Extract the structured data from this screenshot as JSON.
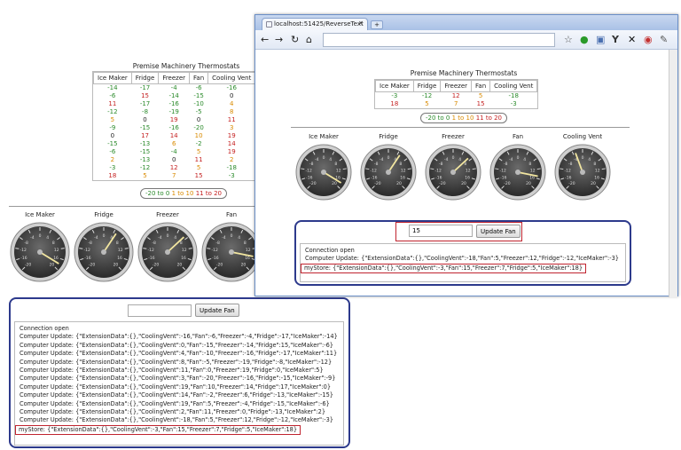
{
  "back": {
    "title": "Premise Machinery Thermostats",
    "columns": [
      "Ice Maker",
      "Fridge",
      "Freezer",
      "Fan",
      "Cooling Vent"
    ],
    "rows": [
      [
        {
          "v": "-14",
          "c": "green"
        },
        {
          "v": "-17",
          "c": "green"
        },
        {
          "v": "-4",
          "c": "green"
        },
        {
          "v": "-6",
          "c": "green"
        },
        {
          "v": "-16",
          "c": "green"
        }
      ],
      [
        {
          "v": "-6",
          "c": "green"
        },
        {
          "v": "15",
          "c": "red"
        },
        {
          "v": "-14",
          "c": "green"
        },
        {
          "v": "-15",
          "c": "green"
        },
        {
          "v": "0",
          "c": "dark"
        }
      ],
      [
        {
          "v": "11",
          "c": "red"
        },
        {
          "v": "-17",
          "c": "green"
        },
        {
          "v": "-16",
          "c": "green"
        },
        {
          "v": "-10",
          "c": "green"
        },
        {
          "v": "4",
          "c": "orange"
        }
      ],
      [
        {
          "v": "-12",
          "c": "green"
        },
        {
          "v": "-8",
          "c": "green"
        },
        {
          "v": "-19",
          "c": "green"
        },
        {
          "v": "-5",
          "c": "green"
        },
        {
          "v": "8",
          "c": "orange"
        }
      ],
      [
        {
          "v": "5",
          "c": "orange"
        },
        {
          "v": "0",
          "c": "dark"
        },
        {
          "v": "19",
          "c": "red"
        },
        {
          "v": "0",
          "c": "dark"
        },
        {
          "v": "11",
          "c": "red"
        }
      ],
      [
        {
          "v": "-9",
          "c": "green"
        },
        {
          "v": "-15",
          "c": "green"
        },
        {
          "v": "-16",
          "c": "green"
        },
        {
          "v": "-20",
          "c": "green"
        },
        {
          "v": "3",
          "c": "orange"
        }
      ],
      [
        {
          "v": "0",
          "c": "dark"
        },
        {
          "v": "17",
          "c": "red"
        },
        {
          "v": "14",
          "c": "red"
        },
        {
          "v": "10",
          "c": "orange"
        },
        {
          "v": "19",
          "c": "red"
        }
      ],
      [
        {
          "v": "-15",
          "c": "green"
        },
        {
          "v": "-13",
          "c": "green"
        },
        {
          "v": "6",
          "c": "orange"
        },
        {
          "v": "-2",
          "c": "green"
        },
        {
          "v": "14",
          "c": "red"
        }
      ],
      [
        {
          "v": "-6",
          "c": "green"
        },
        {
          "v": "-15",
          "c": "green"
        },
        {
          "v": "-4",
          "c": "green"
        },
        {
          "v": "5",
          "c": "orange"
        },
        {
          "v": "19",
          "c": "red"
        }
      ],
      [
        {
          "v": "2",
          "c": "orange"
        },
        {
          "v": "-13",
          "c": "green"
        },
        {
          "v": "0",
          "c": "dark"
        },
        {
          "v": "11",
          "c": "red"
        },
        {
          "v": "2",
          "c": "orange"
        }
      ],
      [
        {
          "v": "-3",
          "c": "green"
        },
        {
          "v": "-12",
          "c": "green"
        },
        {
          "v": "12",
          "c": "red"
        },
        {
          "v": "5",
          "c": "orange"
        },
        {
          "v": "-18",
          "c": "green"
        }
      ],
      [
        {
          "v": "18",
          "c": "red"
        },
        {
          "v": "5",
          "c": "orange"
        },
        {
          "v": "7",
          "c": "orange"
        },
        {
          "v": "15",
          "c": "red"
        },
        {
          "v": "-3",
          "c": "green"
        }
      ]
    ],
    "legend": {
      "green": "-20 to 0",
      "orange": "1 to 10",
      "red": "11 to 20"
    },
    "gauges": [
      {
        "label": "Ice Maker",
        "value": 18
      },
      {
        "label": "Fridge",
        "value": 5
      },
      {
        "label": "Freezer",
        "value": 7
      },
      {
        "label": "Fan",
        "value": 15
      }
    ],
    "input_value": "",
    "button_label": "Update Fan",
    "log": [
      "Connection open",
      "Computer Update: {\"ExtensionData\":{},\"CoolingVent\":-16,\"Fan\":-6,\"Freezer\":-4,\"Fridge\":-17,\"IceMaker\":-14}",
      "Computer Update: {\"ExtensionData\":{},\"CoolingVent\":0,\"Fan\":-15,\"Freezer\":-14,\"Fridge\":15,\"IceMaker\":-6}",
      "Computer Update: {\"ExtensionData\":{},\"CoolingVent\":4,\"Fan\":-10,\"Freezer\":-16,\"Fridge\":-17,\"IceMaker\":11}",
      "Computer Update: {\"ExtensionData\":{},\"CoolingVent\":8,\"Fan\":-5,\"Freezer\":-19,\"Fridge\":-8,\"IceMaker\":-12}",
      "Computer Update: {\"ExtensionData\":{},\"CoolingVent\":11,\"Fan\":0,\"Freezer\":19,\"Fridge\":0,\"IceMaker\":5}",
      "Computer Update: {\"ExtensionData\":{},\"CoolingVent\":3,\"Fan\":-20,\"Freezer\":-16,\"Fridge\":-15,\"IceMaker\":-9}",
      "Computer Update: {\"ExtensionData\":{},\"CoolingVent\":19,\"Fan\":10,\"Freezer\":14,\"Fridge\":17,\"IceMaker\":0}",
      "Computer Update: {\"ExtensionData\":{},\"CoolingVent\":14,\"Fan\":-2,\"Freezer\":6,\"Fridge\":-13,\"IceMaker\":-15}",
      "Computer Update: {\"ExtensionData\":{},\"CoolingVent\":19,\"Fan\":5,\"Freezer\":-4,\"Fridge\":-15,\"IceMaker\":-6}",
      "Computer Update: {\"ExtensionData\":{},\"CoolingVent\":2,\"Fan\":11,\"Freezer\":0,\"Fridge\":-13,\"IceMaker\":2}",
      "Computer Update: {\"ExtensionData\":{},\"CoolingVent\":-18,\"Fan\":5,\"Freezer\":12,\"Fridge\":-12,\"IceMaker\":-3}"
    ],
    "log_highlight": "myStore: {\"ExtensionData\":{},\"CoolingVent\":-3,\"Fan\":15,\"Freezer\":7,\"Fridge\":5,\"IceMaker\":18}"
  },
  "browser": {
    "tab_title": "localhost:51425/ReverseText",
    "tab_close": "×",
    "new_tab": "+",
    "url": "",
    "icons": [
      "back-arrow-icon",
      "forward-arrow-icon",
      "reload-icon",
      "home-icon",
      "star-icon",
      "extension-green-icon",
      "extension-page-icon",
      "extension-yahoo-icon",
      "extension-x-icon",
      "extension-opera-icon",
      "wrench-icon"
    ],
    "title": "Premise Machinery Thermostats",
    "columns": [
      "Ice Maker",
      "Fridge",
      "Freezer",
      "Fan",
      "Cooling Vent"
    ],
    "rows": [
      [
        {
          "v": "-3",
          "c": "green"
        },
        {
          "v": "-12",
          "c": "green"
        },
        {
          "v": "12",
          "c": "red"
        },
        {
          "v": "5",
          "c": "orange"
        },
        {
          "v": "-18",
          "c": "green"
        }
      ],
      [
        {
          "v": "18",
          "c": "red"
        },
        {
          "v": "5",
          "c": "orange"
        },
        {
          "v": "7",
          "c": "orange"
        },
        {
          "v": "15",
          "c": "red"
        },
        {
          "v": "-3",
          "c": "green"
        }
      ]
    ],
    "legend": {
      "green": "-20 to 0",
      "orange": "1 to 10",
      "red": "11 to 20"
    },
    "gauges": [
      {
        "label": "Ice Maker",
        "value": 18
      },
      {
        "label": "Fridge",
        "value": 5
      },
      {
        "label": "Freezer",
        "value": 7
      },
      {
        "label": "Fan",
        "value": 15
      },
      {
        "label": "Cooling Vent",
        "value": -3
      }
    ],
    "input_value": "15",
    "button_label": "Update Fan",
    "log": [
      "Connection open",
      "Computer Update: {\"ExtensionData\":{},\"CoolingVent\":-18,\"Fan\":5,\"Freezer\":12,\"Fridge\":-12,\"IceMaker\":-3}"
    ],
    "log_highlight": "myStore: {\"ExtensionData\":{},\"CoolingVent\":-3,\"Fan\":15,\"Freezer\":7,\"Fridge\":5,\"IceMaker\":18}"
  },
  "gauge_scale": {
    "min": -20,
    "max": 20,
    "ticks": [
      "-20",
      "-16",
      "-12",
      "-8",
      "-4",
      "0",
      "4",
      "8",
      "12",
      "16",
      "20"
    ]
  },
  "colors": {
    "green": "#2a8a2a",
    "orange": "#d98a00",
    "red": "#c41f1f",
    "panel_border": "#2d3a8c",
    "highlight_border": "#c0242f",
    "needle": "#f2e6a0"
  }
}
